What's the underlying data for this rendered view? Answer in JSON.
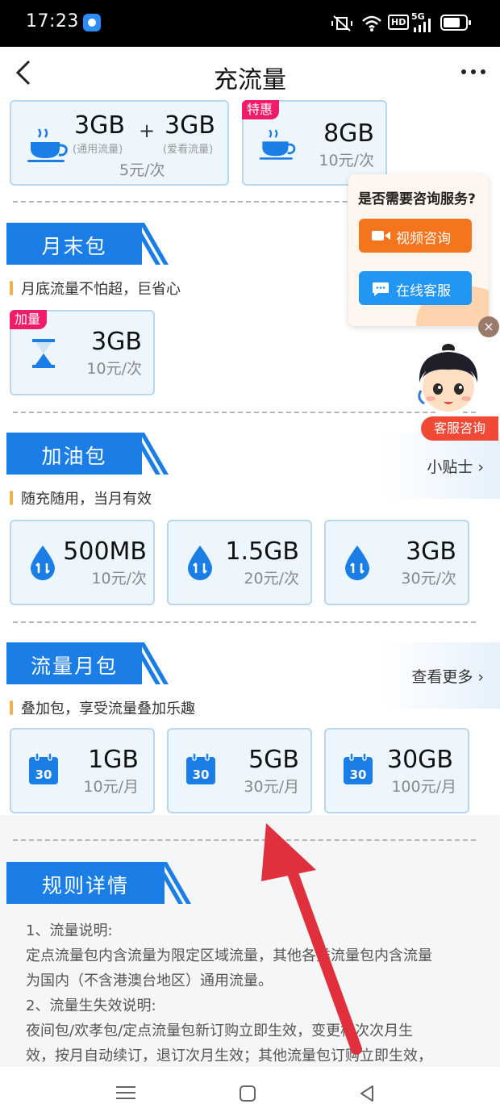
{
  "status_bar": {
    "time": "17:23",
    "hd": "HD",
    "net": "5G"
  },
  "nav": {
    "title": "充流量"
  },
  "top_cards": [
    {
      "amount_a": "3GB",
      "plus": "+",
      "amount_b": "3GB",
      "sub_a": "(通用流量)",
      "sub_b": "(爱看流量)",
      "price": "5元/次"
    },
    {
      "tag": "特惠",
      "amount": "8GB",
      "price": "10元/次"
    }
  ],
  "month_end": {
    "title": "月末包",
    "subtitle": "月底流量不怕超，巨省心",
    "card": {
      "tag": "加量",
      "amount": "3GB",
      "price": "10元/次"
    }
  },
  "refuel": {
    "title": "加油包",
    "tip_link": "小贴士",
    "subtitle": "随充随用，当月有效",
    "cards": [
      {
        "amount": "500MB",
        "price": "10元/次"
      },
      {
        "amount": "1.5GB",
        "price": "20元/次"
      },
      {
        "amount": "3GB",
        "price": "30元/次"
      }
    ]
  },
  "monthly": {
    "title": "流量月包",
    "more_link": "查看更多",
    "subtitle": "叠加包，享受流量叠加乐趣",
    "calendar_num": "30",
    "cards": [
      {
        "amount": "1GB",
        "price": "10元/月"
      },
      {
        "amount": "5GB",
        "price": "30元/月"
      },
      {
        "amount": "30GB",
        "price": "100元/月"
      }
    ]
  },
  "rules": {
    "title": "规则详情",
    "lines": [
      "1、流量说明:",
      "定点流量包内含流量为限定区域流量，其他各类流量包内含流量",
      "为国内（不含港澳台地区）通用流量。",
      "2、流量生失效说明:",
      "夜间包/欢孝包/定点流量包新订购立即生效，变更档次次月生",
      "效，按月自动续订，退订次月生效；其他流量包订购立即生效，"
    ]
  },
  "consult_popup": {
    "question": "是否需要咨询服务?",
    "video_btn": "视频咨询",
    "online_btn": "在线客服",
    "close": "×",
    "avatar_caption": "客服咨询"
  },
  "colors": {
    "brand_blue": "#1a7ee6",
    "tag_pink": "#f01c6a",
    "video_orange": "#f5751f",
    "online_blue": "#2196f3",
    "arrow_red": "#e0303e"
  }
}
